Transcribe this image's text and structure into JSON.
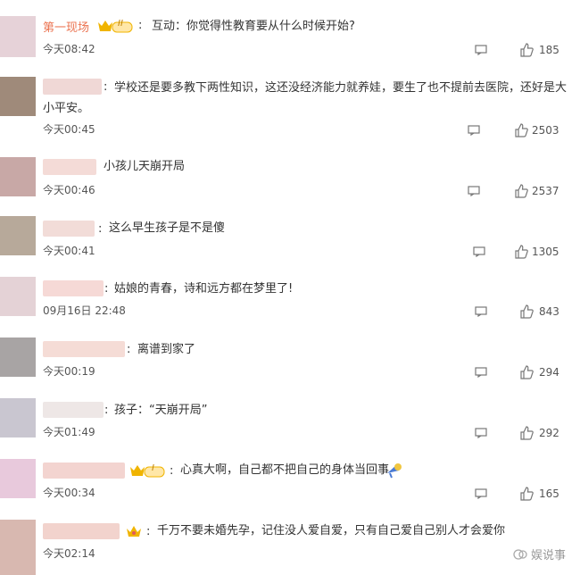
{
  "colors": {
    "accent_name": "#eb7350",
    "badge_gold": "#f0b400",
    "badge_purple": "#7a5cc4"
  },
  "comments": [
    {
      "name": "第一现场",
      "badge": "II",
      "content": "互动：你觉得性教育要从什么时候开始?",
      "time": "今天08:42",
      "likes": "185",
      "avatar_color": "#e6d2d8",
      "name_color": ""
    },
    {
      "name": "",
      "badge": "",
      "content": "学校还是要多教下两性知识，这还没经济能力就养娃，要生了也不提前去医院，还好是大",
      "content2": "小平安。",
      "time": "今天00:45",
      "likes": "2503",
      "avatar_color": "#9f8a7a",
      "name_color": "#f0d8d6"
    },
    {
      "name": "",
      "badge": "",
      "content": "小孩儿天崩开局",
      "time": "今天00:46",
      "likes": "2537",
      "avatar_color": "#c8a8a6",
      "name_color": "#f4dbd7"
    },
    {
      "name": "",
      "badge": "",
      "content": "这么早生孩子是不是傻",
      "time": "今天00:41",
      "likes": "1305",
      "avatar_color": "#b7a99a",
      "name_color": "#f2dcd8"
    },
    {
      "name": "",
      "badge": "",
      "content": "姑娘的青春，诗和远方都在梦里了!",
      "time": "09月16日 22:48",
      "likes": "843",
      "avatar_color": "#e4d2d6",
      "name_color": "#f6d9d6"
    },
    {
      "name": "",
      "badge": "",
      "content": "离谱到家了",
      "time": "今天00:19",
      "likes": "294",
      "avatar_color": "#a8a4a4",
      "name_color": "#f5dcd6"
    },
    {
      "name": "",
      "badge": "",
      "content": "孩子：“天崩开局”",
      "time": "今天01:49",
      "likes": "292",
      "avatar_color": "#c9c6d0",
      "name_color": "#eee7e6"
    },
    {
      "name": "",
      "badge": "I",
      "content": "心真大啊，自己都不把自己的身体当回事",
      "time": "今天00:34",
      "likes": "165",
      "avatar_color": "#e8c9dc",
      "name_color": "#f3d4d0"
    },
    {
      "name": "",
      "badge": "crown",
      "content": "千万不要未婚先孕，记住没人爱自爱，只有自己爱自己别人才会爱你",
      "time": "今天02:14",
      "likes": "",
      "avatar_color": "#d8b8b0",
      "name_color": "#f2d3cd"
    }
  ],
  "watermark": "娱说事"
}
